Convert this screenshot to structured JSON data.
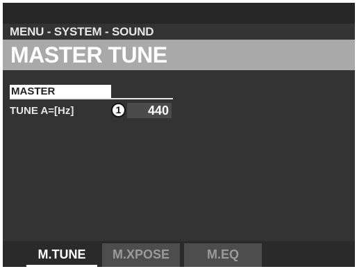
{
  "breadcrumb": "MENU - SYSTEM - SOUND",
  "title": "MASTER TUNE",
  "section": {
    "label": "MASTER"
  },
  "parameter": {
    "label": "TUNE  A=[Hz]",
    "callout": "1",
    "value": "440"
  },
  "tabs": [
    {
      "label": "M.TUNE",
      "active": true
    },
    {
      "label": "M.XPOSE",
      "active": false
    },
    {
      "label": "M.EQ",
      "active": false
    }
  ],
  "colors": {
    "screen_bg": "#333333",
    "title_bar": "#a9a9a9",
    "text": "#e6e6e6",
    "tab_inactive_bg": "#4d4d4d"
  }
}
